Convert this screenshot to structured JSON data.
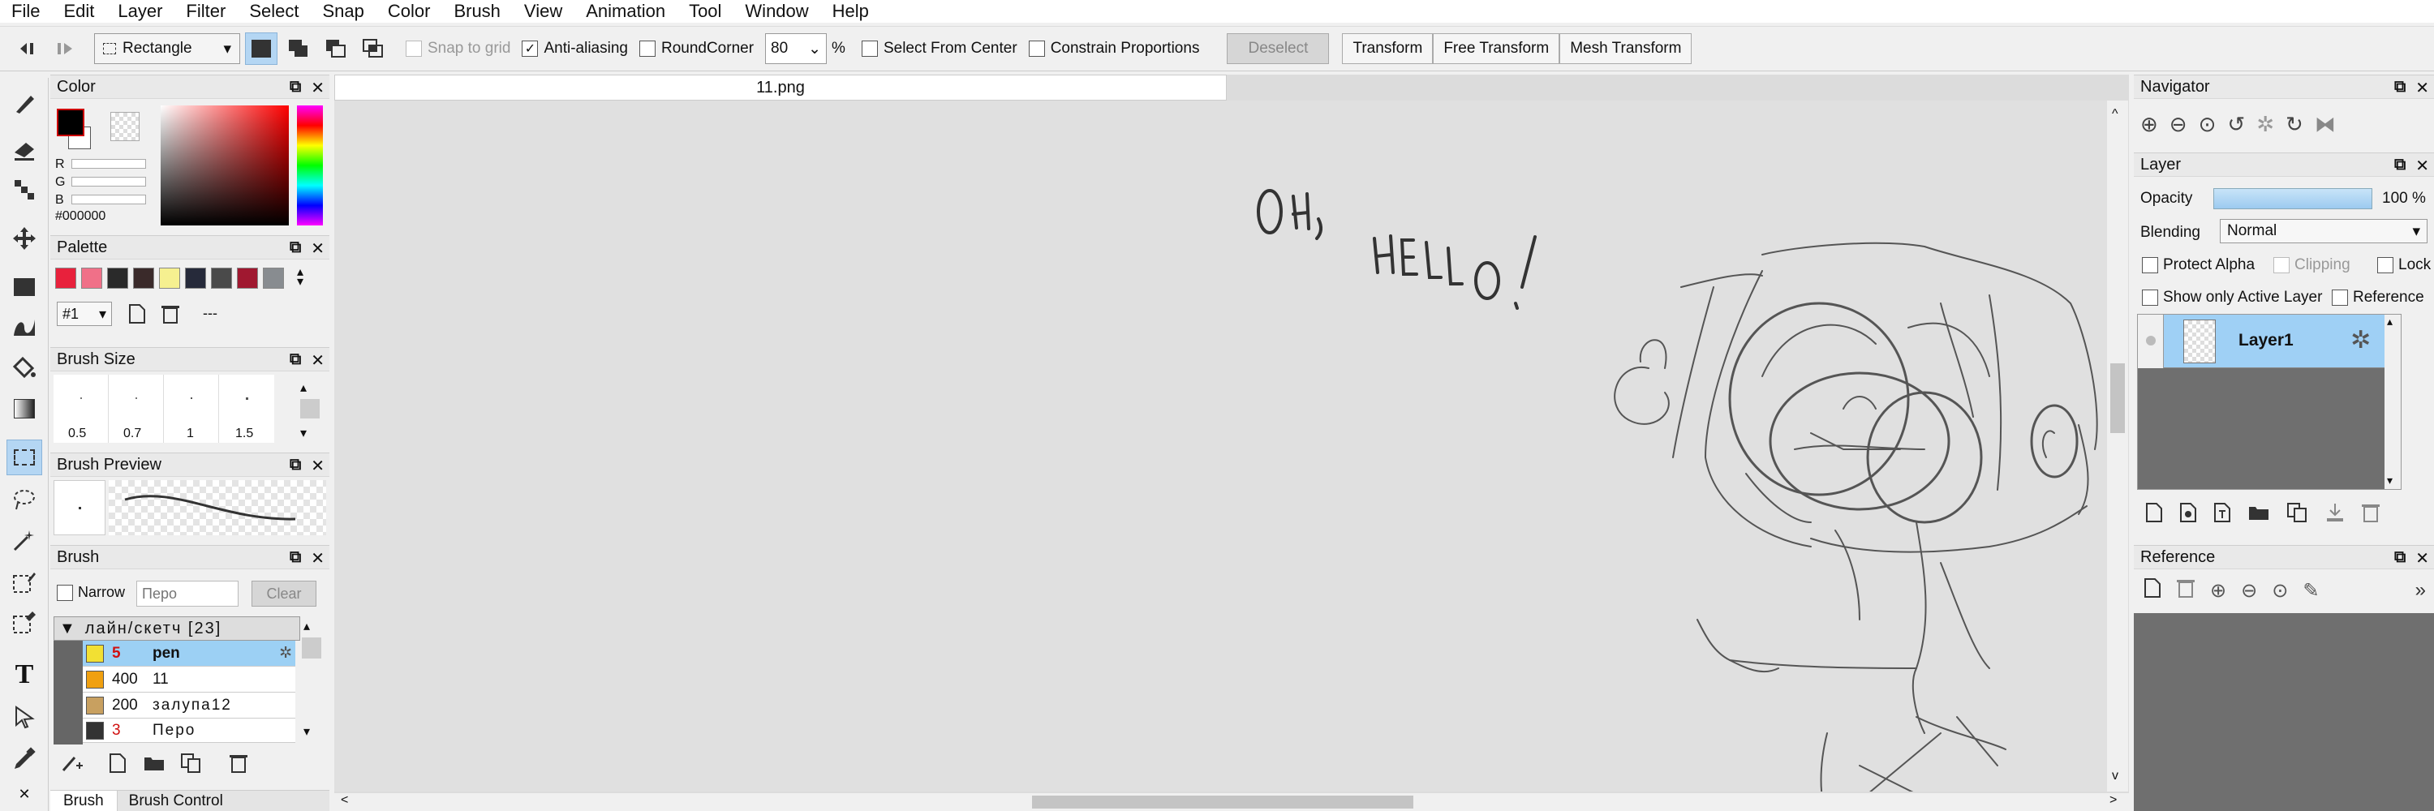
{
  "menu": [
    "File",
    "Edit",
    "Layer",
    "Filter",
    "Select",
    "Snap",
    "Color",
    "Brush",
    "View",
    "Animation",
    "Tool",
    "Window",
    "Help"
  ],
  "toolbar": {
    "shape_select": "Rectangle",
    "snap_to_grid": "Snap to grid",
    "anti_aliasing": "Anti-aliasing",
    "round_corner": "RoundCorner",
    "round_value": "80",
    "percent": "%",
    "select_from_center": "Select From Center",
    "constrain_proportions": "Constrain Proportions",
    "deselect": "Deselect",
    "transform": "Transform",
    "free_transform": "Free Transform",
    "mesh_transform": "Mesh Transform"
  },
  "color_panel": {
    "title": "Color",
    "r": "R",
    "g": "G",
    "b": "B",
    "hex": "#000000",
    "foreground": "#000000",
    "background": "#ffffff"
  },
  "palette_panel": {
    "title": "Palette",
    "swatches": [
      "#e8213c",
      "#f07088",
      "#2a2a2a",
      "#3a2a2a",
      "#f6f090",
      "#262a3a",
      "#4a4a4a",
      "#a01830",
      "#888c90"
    ],
    "set": "#1",
    "dashes": "---"
  },
  "brush_size_panel": {
    "title": "Brush Size",
    "sizes": [
      "0.5",
      "0.7",
      "1",
      "1.5"
    ]
  },
  "brush_preview_panel": {
    "title": "Brush Preview"
  },
  "brush_panel": {
    "title": "Brush",
    "narrow": "Narrow",
    "search_placeholder": "Перо",
    "clear": "Clear",
    "group": "лайн/скетч [23]",
    "items": [
      {
        "size": "5",
        "name": "pen",
        "color": "#f2e033"
      },
      {
        "size": "400",
        "name": "11",
        "color": "#f0a010"
      },
      {
        "size": "200",
        "name": "залупа12",
        "color": "#c8a060"
      },
      {
        "size": "3",
        "name": "Перо",
        "color": "#333333"
      }
    ],
    "tabs": [
      "Brush",
      "Brush Control"
    ]
  },
  "document": {
    "tab": "11.png",
    "sketch_text_1": "OH,",
    "sketch_text_2": "HELLO!"
  },
  "navigator_panel": {
    "title": "Navigator"
  },
  "layer_panel": {
    "title": "Layer",
    "opacity_label": "Opacity",
    "opacity_value": "100 %",
    "opacity": 1.0,
    "blending_label": "Blending",
    "blending_value": "Normal",
    "protect_alpha": "Protect Alpha",
    "clipping": "Clipping",
    "lock": "Lock",
    "show_only_active": "Show only Active Layer",
    "reference": "Reference",
    "layer_name": "Layer1"
  },
  "reference_panel": {
    "title": "Reference"
  },
  "colors": {
    "accent": "#b4d6f3",
    "panel": "#f0f0f0",
    "canvas": "#e0e0e0"
  }
}
